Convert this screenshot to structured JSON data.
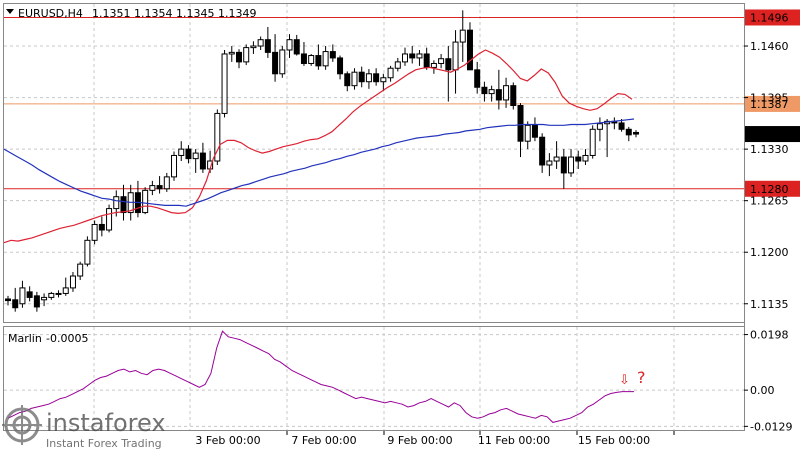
{
  "chart_data": {
    "type": "candlestick",
    "title": "EURUSD,H4",
    "ohlc_header": "1.1351 1.1354 1.1345 1.1349",
    "price_axis_ticks": [
      {
        "label": "1.1460",
        "value": 1.146
      },
      {
        "label": "1.1395",
        "value": 1.1395
      },
      {
        "label": "1.1330",
        "value": 1.133
      },
      {
        "label": "1.1265",
        "value": 1.1265
      },
      {
        "label": "1.1200",
        "value": 1.12
      },
      {
        "label": "1.1135",
        "value": 1.1135
      }
    ],
    "time_axis_labels": [
      "3 Feb 00:00",
      "7 Feb 00:00",
      "9 Feb 00:00",
      "11 Feb 00:00",
      "15 Feb 00:00"
    ],
    "horizontal_levels": [
      {
        "label": "1.1496",
        "value": 1.1496,
        "color": "#dd2222"
      },
      {
        "label": "1.1387",
        "value": 1.1387,
        "color": "#ee9966"
      },
      {
        "label": "1.1280",
        "value": 1.128,
        "color": "#dd2222"
      }
    ],
    "current_price": {
      "label": "1.1349",
      "value": 1.1349
    },
    "price_range": [
      1.1112,
      1.1513
    ],
    "ma_red": [
      1.1212,
      1.1215,
      1.1214,
      1.1216,
      1.1218,
      1.1221,
      1.1224,
      1.1227,
      1.123,
      1.1232,
      1.1234,
      1.1237,
      1.124,
      1.1243,
      1.1246,
      1.1248,
      1.125,
      1.1251,
      1.1252,
      1.1255,
      1.1258,
      1.1258,
      1.1256,
      1.1253,
      1.125,
      1.1249,
      1.125,
      1.1256,
      1.127,
      1.129,
      1.1318,
      1.1336,
      1.1341,
      1.1341,
      1.1338,
      1.1332,
      1.1328,
      1.1325,
      1.1327,
      1.133,
      1.1333,
      1.1335,
      1.1337,
      1.134,
      1.1342,
      1.1343,
      1.1347,
      1.1352,
      1.136,
      1.1368,
      1.1377,
      1.1384,
      1.139,
      1.1396,
      1.1402,
      1.1408,
      1.1413,
      1.1419,
      1.1425,
      1.143,
      1.1432,
      1.1433,
      1.1431,
      1.1429,
      1.1427,
      1.1431,
      1.1436,
      1.1443,
      1.145,
      1.1455,
      1.1451,
      1.1446,
      1.1438,
      1.1429,
      1.1419,
      1.1416,
      1.1423,
      1.1431,
      1.1426,
      1.1414,
      1.1397,
      1.1388,
      1.1384,
      1.1381,
      1.1379,
      1.1381,
      1.1387,
      1.1394,
      1.14,
      1.1399,
      1.1393
    ],
    "ma_blue": [
      1.133,
      1.1325,
      1.132,
      1.1315,
      1.131,
      1.1304,
      1.1299,
      1.1294,
      1.1289,
      1.1285,
      1.1281,
      1.1277,
      1.1274,
      1.1271,
      1.1268,
      1.1267,
      1.1265,
      1.1264,
      1.1263,
      1.1263,
      1.1262,
      1.1261,
      1.126,
      1.1259,
      1.1259,
      1.1259,
      1.1258,
      1.1261,
      1.1264,
      1.1267,
      1.1271,
      1.1275,
      1.1278,
      1.1281,
      1.1284,
      1.1286,
      1.1289,
      1.1292,
      1.1295,
      1.1297,
      1.1299,
      1.1302,
      1.1304,
      1.1306,
      1.1309,
      1.1311,
      1.1313,
      1.1316,
      1.1318,
      1.1321,
      1.1323,
      1.1326,
      1.1328,
      1.133,
      1.1333,
      1.1335,
      1.1338,
      1.134,
      1.1342,
      1.1344,
      1.1345,
      1.1346,
      1.1347,
      1.1349,
      1.135,
      1.1351,
      1.1353,
      1.1354,
      1.1355,
      1.1357,
      1.1358,
      1.1359,
      1.136,
      1.136,
      1.1361,
      1.1361,
      1.1361,
      1.1361,
      1.136,
      1.136,
      1.136,
      1.1361,
      1.1361,
      1.1361,
      1.1362,
      1.1363,
      1.1364,
      1.1365,
      1.1366,
      1.1367,
      1.1368
    ],
    "candles": [
      [
        1.1141,
        1.1145,
        1.1133,
        1.1139
      ],
      [
        1.114,
        1.1155,
        1.1125,
        1.113
      ],
      [
        1.1135,
        1.1164,
        1.113,
        1.1155
      ],
      [
        1.115,
        1.1157,
        1.1138,
        1.1143
      ],
      [
        1.1145,
        1.115,
        1.1125,
        1.1131
      ],
      [
        1.114,
        1.1148,
        1.1132,
        1.1143
      ],
      [
        1.1143,
        1.115,
        1.114,
        1.1148
      ],
      [
        1.1148,
        1.1152,
        1.1143,
        1.1148
      ],
      [
        1.1148,
        1.1168,
        1.1145,
        1.1155
      ],
      [
        1.1155,
        1.1175,
        1.115,
        1.117
      ],
      [
        1.117,
        1.1188,
        1.1165,
        1.1185
      ],
      [
        1.1185,
        1.122,
        1.1182,
        1.1215
      ],
      [
        1.1215,
        1.124,
        1.121,
        1.1235
      ],
      [
        1.1235,
        1.1245,
        1.122,
        1.1228
      ],
      [
        1.1228,
        1.126,
        1.1225,
        1.1255
      ],
      [
        1.1255,
        1.1278,
        1.1245,
        1.127
      ],
      [
        1.127,
        1.1285,
        1.124,
        1.125
      ],
      [
        1.125,
        1.1285,
        1.124,
        1.1275
      ],
      [
        1.1275,
        1.129,
        1.1244,
        1.125
      ],
      [
        1.125,
        1.1282,
        1.1248,
        1.1278
      ],
      [
        1.1278,
        1.129,
        1.1272,
        1.1284
      ],
      [
        1.1284,
        1.1296,
        1.1274,
        1.128
      ],
      [
        1.128,
        1.13,
        1.1276,
        1.1295
      ],
      [
        1.1295,
        1.1327,
        1.129,
        1.1322
      ],
      [
        1.1322,
        1.134,
        1.1315,
        1.133
      ],
      [
        1.133,
        1.1335,
        1.1312,
        1.1318
      ],
      [
        1.1318,
        1.133,
        1.13,
        1.1325
      ],
      [
        1.1325,
        1.1338,
        1.13,
        1.1305
      ],
      [
        1.1305,
        1.1328,
        1.13,
        1.1315
      ],
      [
        1.1315,
        1.138,
        1.131,
        1.1375
      ],
      [
        1.1375,
        1.1455,
        1.137,
        1.145
      ],
      [
        1.145,
        1.146,
        1.144,
        1.1452
      ],
      [
        1.1452,
        1.1456,
        1.1432,
        1.144
      ],
      [
        1.144,
        1.1462,
        1.1436,
        1.1458
      ],
      [
        1.1458,
        1.1466,
        1.145,
        1.146
      ],
      [
        1.146,
        1.1472,
        1.1455,
        1.1468
      ],
      [
        1.1468,
        1.1484,
        1.1445,
        1.1452
      ],
      [
        1.1452,
        1.1475,
        1.1415,
        1.1425
      ],
      [
        1.1425,
        1.146,
        1.142,
        1.1455
      ],
      [
        1.1455,
        1.1475,
        1.1445,
        1.1468
      ],
      [
        1.1468,
        1.1474,
        1.1448,
        1.145
      ],
      [
        1.145,
        1.1465,
        1.1435,
        1.1438
      ],
      [
        1.1438,
        1.145,
        1.1435,
        1.1448
      ],
      [
        1.1448,
        1.1462,
        1.143,
        1.1435
      ],
      [
        1.1435,
        1.146,
        1.143,
        1.1453
      ],
      [
        1.1453,
        1.1462,
        1.144,
        1.1445
      ],
      [
        1.1445,
        1.1448,
        1.1418,
        1.1425
      ],
      [
        1.1425,
        1.1428,
        1.1403,
        1.141
      ],
      [
        1.141,
        1.1432,
        1.1405,
        1.1427
      ],
      [
        1.1427,
        1.1434,
        1.1408,
        1.1415
      ],
      [
        1.1415,
        1.1431,
        1.1406,
        1.1425
      ],
      [
        1.1425,
        1.1432,
        1.141,
        1.1415
      ],
      [
        1.1415,
        1.1425,
        1.1403,
        1.142
      ],
      [
        1.142,
        1.1435,
        1.1415,
        1.1432
      ],
      [
        1.1432,
        1.1445,
        1.1428,
        1.144
      ],
      [
        1.144,
        1.1458,
        1.1435,
        1.145
      ],
      [
        1.145,
        1.146,
        1.1438,
        1.1445
      ],
      [
        1.1445,
        1.1455,
        1.1435,
        1.145
      ],
      [
        1.145,
        1.1458,
        1.143,
        1.1433
      ],
      [
        1.1433,
        1.1442,
        1.1425,
        1.1438
      ],
      [
        1.1438,
        1.145,
        1.1432,
        1.1444
      ],
      [
        1.1444,
        1.146,
        1.139,
        1.143
      ],
      [
        1.143,
        1.148,
        1.14,
        1.1465
      ],
      [
        1.1465,
        1.1505,
        1.144,
        1.148
      ],
      [
        1.148,
        1.149,
        1.144,
        1.143
      ],
      [
        1.143,
        1.144,
        1.14,
        1.1408
      ],
      [
        1.1408,
        1.1415,
        1.139,
        1.14
      ],
      [
        1.14,
        1.141,
        1.139,
        1.1405
      ],
      [
        1.1405,
        1.143,
        1.138,
        1.1392
      ],
      [
        1.1392,
        1.142,
        1.1382,
        1.141
      ],
      [
        1.141,
        1.1414,
        1.138,
        1.1385
      ],
      [
        1.1385,
        1.1388,
        1.132,
        1.134
      ],
      [
        1.134,
        1.1365,
        1.133,
        1.136
      ],
      [
        1.136,
        1.137,
        1.134,
        1.1345
      ],
      [
        1.1345,
        1.135,
        1.13,
        1.131
      ],
      [
        1.131,
        1.1325,
        1.1296,
        1.1315
      ],
      [
        1.1315,
        1.134,
        1.1305,
        1.132
      ],
      [
        1.132,
        1.133,
        1.128,
        1.13
      ],
      [
        1.13,
        1.133,
        1.1295,
        1.132
      ],
      [
        1.132,
        1.1328,
        1.1305,
        1.1315
      ],
      [
        1.1315,
        1.133,
        1.131,
        1.1322
      ],
      [
        1.1322,
        1.136,
        1.1318,
        1.1355
      ],
      [
        1.1355,
        1.137,
        1.134,
        1.1362
      ],
      [
        1.1362,
        1.1368,
        1.132,
        1.1365
      ],
      [
        1.1365,
        1.137,
        1.1355,
        1.1363
      ],
      [
        1.1363,
        1.1368,
        1.1352,
        1.1355
      ],
      [
        1.1355,
        1.1358,
        1.134,
        1.1348
      ],
      [
        1.1351,
        1.1354,
        1.1345,
        1.1349
      ]
    ],
    "indicator": {
      "name": "Marlin",
      "value_label": "-0.0005",
      "axis_ticks": [
        {
          "label": "0.0198",
          "value": 0.0198
        },
        {
          "label": "0.00",
          "value": 0
        },
        {
          "label": "-0.0129",
          "value": -0.0129
        }
      ],
      "range": [
        -0.0142,
        0.0225
      ],
      "values": [
        -0.01,
        -0.009,
        -0.008,
        -0.0075,
        -0.0065,
        -0.006,
        -0.0055,
        -0.005,
        -0.004,
        -0.003,
        -0.0025,
        -0.0015,
        -0.0005,
        0.0005,
        0.002,
        0.0035,
        0.0045,
        0.005,
        0.006,
        0.007,
        0.0075,
        0.0065,
        0.007,
        0.006,
        0.0055,
        0.007,
        0.0075,
        0.007,
        0.006,
        0.005,
        0.004,
        0.003,
        0.002,
        0.001,
        0.002,
        0.006,
        0.015,
        0.021,
        0.019,
        0.0185,
        0.018,
        0.017,
        0.016,
        0.015,
        0.014,
        0.013,
        0.011,
        0.01,
        0.0085,
        0.007,
        0.006,
        0.005,
        0.004,
        0.003,
        0.002,
        0.0015,
        0.001,
        0.0,
        -0.001,
        -0.002,
        -0.003,
        -0.0025,
        -0.003,
        -0.0035,
        -0.004,
        -0.0045,
        -0.004,
        -0.0045,
        -0.005,
        -0.006,
        -0.0055,
        -0.0045,
        -0.004,
        -0.003,
        -0.004,
        -0.005,
        -0.006,
        -0.0045,
        -0.0055,
        -0.008,
        -0.0095,
        -0.01,
        -0.0095,
        -0.0085,
        -0.008,
        -0.007,
        -0.0065,
        -0.0075,
        -0.0085,
        -0.009,
        -0.0095,
        -0.01,
        -0.009,
        -0.0095,
        -0.0115,
        -0.011,
        -0.0105,
        -0.01,
        -0.009,
        -0.008,
        -0.006,
        -0.005,
        -0.0035,
        -0.002,
        -0.0012,
        -0.0008,
        -0.0005,
        -0.0005,
        -0.0005
      ],
      "annotation": {
        "arrow": "⇩",
        "mark": "?"
      }
    }
  },
  "watermark": {
    "brand": "instaforex",
    "tagline": "Instant Forex Trading"
  },
  "colors": {
    "candle": "#000000",
    "ma_red": "#dd2233",
    "ma_blue": "#2233bb",
    "indicator": "#990099",
    "level_red": "#dd2222",
    "level_orange": "#ee9966",
    "grid": "#c8c8c8"
  }
}
